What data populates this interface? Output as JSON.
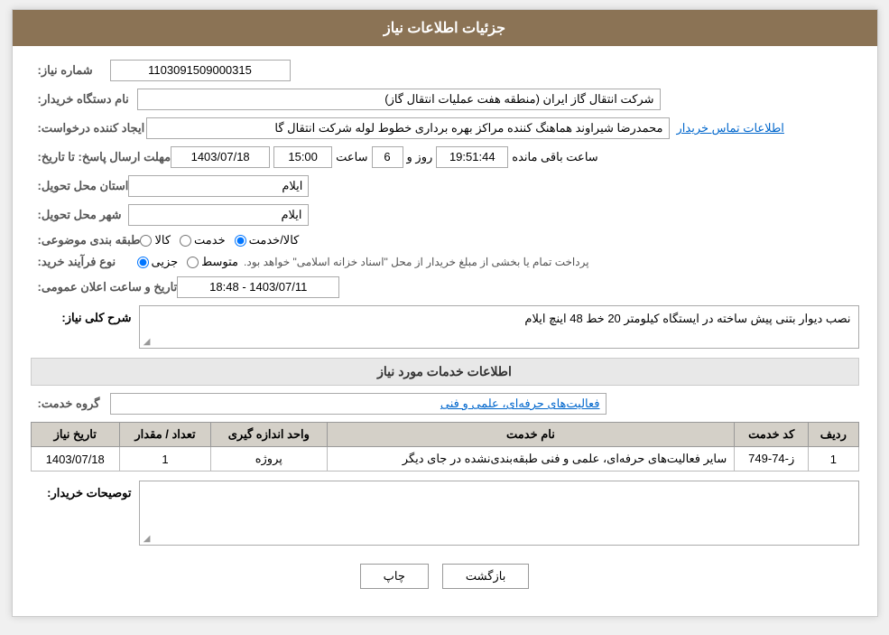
{
  "header": {
    "title": "جزئیات اطلاعات نیاز"
  },
  "fields": {
    "need_number_label": "شماره نیاز:",
    "need_number_value": "1103091509000315",
    "requester_label": "نام دستگاه خریدار:",
    "requester_value": "شرکت انتقال گاز ایران (منطقه هفت عملیات انتقال گاز)",
    "creator_label": "ایجاد کننده درخواست:",
    "creator_value": "محمدرضا شیراوند هماهنگ کننده مراکز بهره برداری خطوط لوله  شرکت انتقال گا",
    "creator_link": "اطلاعات تماس خریدار",
    "response_date_label": "مهلت ارسال پاسخ: تا تاریخ:",
    "response_date": "1403/07/18",
    "response_time_label": "ساعت",
    "response_time": "15:00",
    "response_days_label": "روز و",
    "response_days": "6",
    "remaining_time_label": "ساعت باقی مانده",
    "remaining_time": "19:51:44",
    "province_label": "استان محل تحویل:",
    "province_value": "ایلام",
    "city_label": "شهر محل تحویل:",
    "city_value": "ایلام",
    "category_label": "طبقه بندی موضوعی:",
    "category_options": [
      "کالا",
      "خدمت",
      "کالا/خدمت"
    ],
    "category_selected": "کالا/خدمت",
    "purchase_type_label": "نوع فرآیند خرید:",
    "purchase_type_options": [
      "جزیی",
      "متوسط"
    ],
    "purchase_type_note": "پرداخت تمام یا بخشی از مبلغ خریدار از محل \"اسناد خزانه اسلامی\" خواهد بود.",
    "public_announce_label": "تاریخ و ساعت اعلان عمومی:",
    "public_announce_value": "1403/07/11 - 18:48",
    "announce_date_box": "1403/07/11 - 18:48"
  },
  "need_desc": {
    "section_title": "شرح کلی نیاز:",
    "value": "نصب دیوار بتنی پیش ساخته در ایستگاه کیلومتر 20  خط 48 اینچ ایلام"
  },
  "services_info": {
    "section_title": "اطلاعات خدمات مورد نیاز",
    "service_group_label": "گروه خدمت:",
    "service_group_value": "فعالیت‌های حرفه‌ای، علمی و فنی",
    "table": {
      "columns": [
        "ردیف",
        "کد خدمت",
        "نام خدمت",
        "واحد اندازه گیری",
        "تعداد / مقدار",
        "تاریخ نیاز"
      ],
      "rows": [
        {
          "row_num": "1",
          "service_code": "ز-74-749",
          "service_name": "سایر فعالیت‌های حرفه‌ای، علمی و فنی طبقه‌بندی‌نشده در جای دیگر",
          "unit": "پروژه",
          "quantity": "1",
          "need_date": "1403/07/18"
        }
      ]
    }
  },
  "buyer_comments": {
    "label": "توصیحات خریدار:"
  },
  "buttons": {
    "print": "چاپ",
    "back": "بازگشت"
  }
}
